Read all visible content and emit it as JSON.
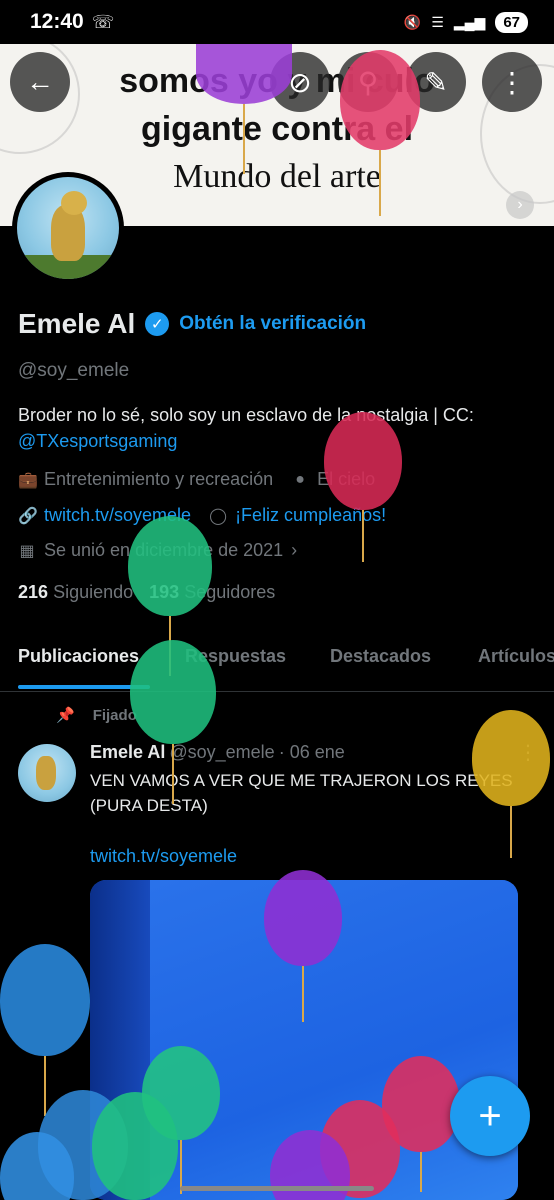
{
  "status_bar": {
    "time": "12:40",
    "battery": "67"
  },
  "banner": {
    "line1": "somos yo y mi culo",
    "line2": "gigante contra el",
    "line3": "Mundo del arte"
  },
  "profile": {
    "name": "Emele Al",
    "verify_link": "Obtén la verificación",
    "handle": "@soy_emele",
    "bio_text": "Broder no lo sé, solo soy un esclavo de la nostalgia | CC:",
    "bio_mention": "@TXesportsgaming",
    "category": "Entretenimiento y recreación",
    "location": "El cielo",
    "website": "twitch.tv/soyemele",
    "birthday": "¡Feliz cumpleaños!",
    "joined": "Se unió en diciembre de 2021",
    "following_count": "216",
    "following_label": "Siguiendo",
    "followers_count": "193",
    "followers_label": "Seguidores"
  },
  "tabs": [
    {
      "label": "Publicaciones"
    },
    {
      "label": "Respuestas"
    },
    {
      "label": "Destacados"
    },
    {
      "label": "Artículos"
    }
  ],
  "post": {
    "pinned_label": "Fijado",
    "author_name": "Emele Al",
    "author_handle": "@soy_emele",
    "date": "· 06 ene",
    "text": "VEN VAMOS A VER QUE ME TRAJERON LOS REYES (PURA DESTA)",
    "link": "twitch.tv/soyemele"
  },
  "colors": {
    "accent": "#1d9bf0",
    "background": "#000000",
    "muted": "#71767b"
  },
  "icons": {
    "back": "arrow-left-icon",
    "grok": "grok-icon",
    "search": "search-icon",
    "edit": "pencil-icon",
    "more": "more-vertical-icon",
    "compose": "plus-icon"
  }
}
